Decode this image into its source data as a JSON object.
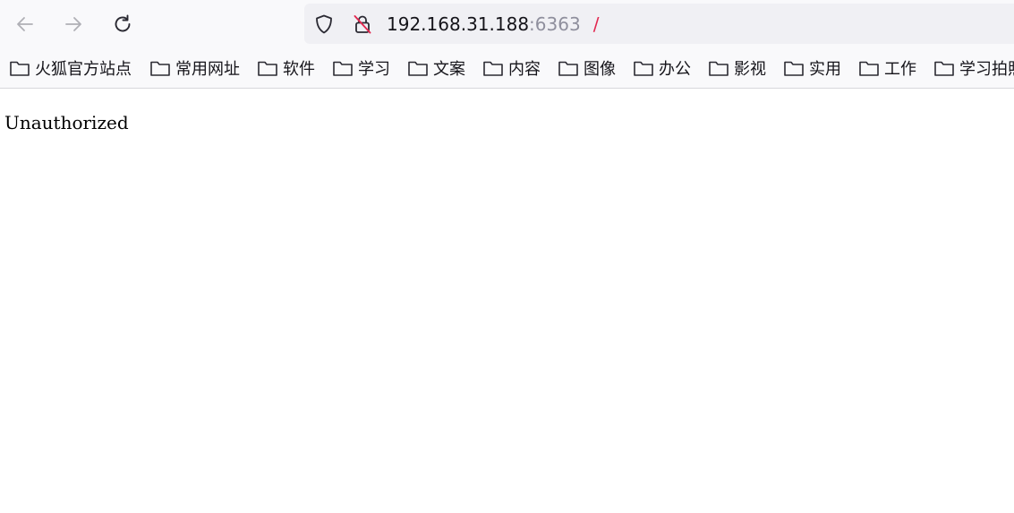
{
  "toolbar": {
    "back_icon": "arrow-left-icon",
    "forward_icon": "arrow-right-icon",
    "reload_icon": "reload-icon"
  },
  "urlbar": {
    "host": "192.168.31.188",
    "port": ":6363",
    "path": "/",
    "shield_icon": "shield-icon",
    "insecure_lock_icon": "insecure-lock-icon",
    "insecure_color": "#e22850"
  },
  "bookmarks": {
    "items": [
      {
        "label": "火狐官方站点"
      },
      {
        "label": "常用网址"
      },
      {
        "label": "软件"
      },
      {
        "label": "学习"
      },
      {
        "label": "文案"
      },
      {
        "label": "内容"
      },
      {
        "label": "图像"
      },
      {
        "label": "办公"
      },
      {
        "label": "影视"
      },
      {
        "label": "实用"
      },
      {
        "label": "工作"
      },
      {
        "label": "学习拍照"
      }
    ]
  },
  "page": {
    "body_text": "Unauthorized"
  }
}
